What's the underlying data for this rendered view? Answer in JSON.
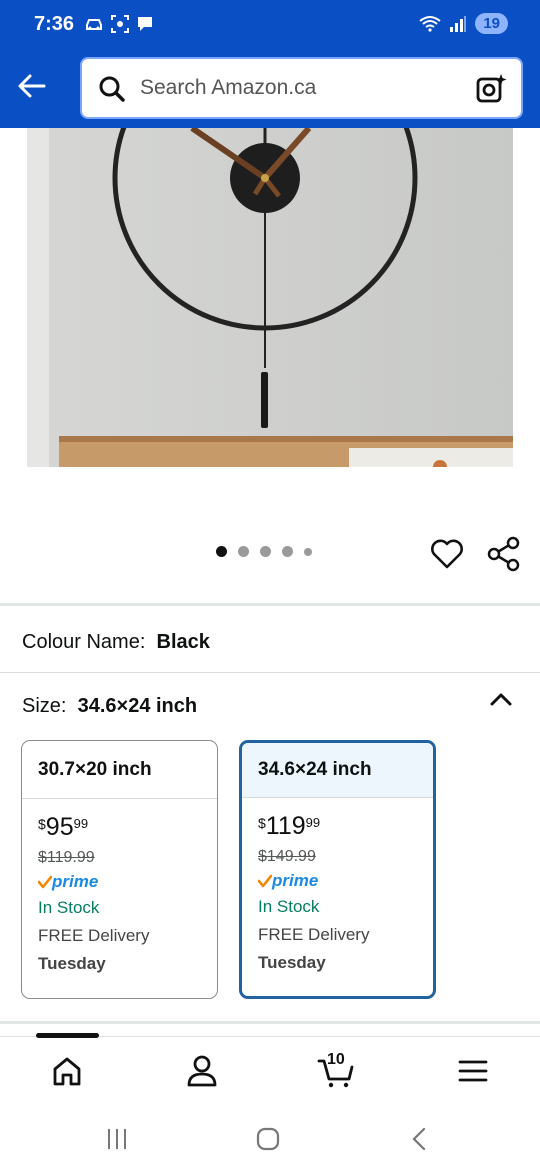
{
  "status_bar": {
    "time": "7:36",
    "battery": "19"
  },
  "search": {
    "placeholder": "Search Amazon.ca"
  },
  "product": {
    "image_dots": 5,
    "colour_label": "Colour Name:",
    "colour_value": "Black",
    "size_label": "Size:",
    "size_value": "34.6×24 inch"
  },
  "size_options": [
    {
      "name": "30.7×20 inch",
      "currency": "$",
      "price_dollars": "95",
      "price_cents": "99",
      "list_price": "$119.99",
      "prime": "prime",
      "stock": "In Stock",
      "delivery": "FREE Delivery",
      "delivery_day": "Tuesday",
      "selected": false
    },
    {
      "name": "34.6×24 inch",
      "currency": "$",
      "price_dollars": "119",
      "price_cents": "99",
      "list_price": "$149.99",
      "prime": "prime",
      "stock": "In Stock",
      "delivery": "FREE Delivery",
      "delivery_day": "Tuesday",
      "selected": true
    }
  ],
  "bottom_nav": {
    "cart_count": "10"
  },
  "colors": {
    "header_blue": "#0a4fc4",
    "selected_border": "#2162a1",
    "prime_blue": "#1a8ae5",
    "stock_green": "#067d62"
  }
}
